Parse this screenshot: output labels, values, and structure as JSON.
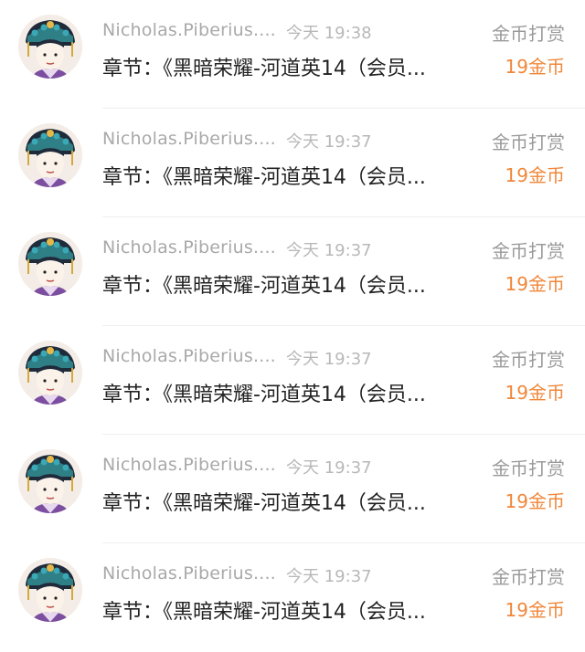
{
  "items": [
    {
      "user": "Nicholas.Piberius....",
      "time": "今天 19:38",
      "action": "金币打赏",
      "chapter": "章节：《黑暗荣耀-河道英14（会员...",
      "amount": "19金币"
    },
    {
      "user": "Nicholas.Piberius....",
      "time": "今天 19:37",
      "action": "金币打赏",
      "chapter": "章节：《黑暗荣耀-河道英14（会员...",
      "amount": "19金币"
    },
    {
      "user": "Nicholas.Piberius....",
      "time": "今天 19:37",
      "action": "金币打赏",
      "chapter": "章节：《黑暗荣耀-河道英14（会员...",
      "amount": "19金币"
    },
    {
      "user": "Nicholas.Piberius....",
      "time": "今天 19:37",
      "action": "金币打赏",
      "chapter": "章节：《黑暗荣耀-河道英14（会员...",
      "amount": "19金币"
    },
    {
      "user": "Nicholas.Piberius....",
      "time": "今天 19:37",
      "action": "金币打赏",
      "chapter": "章节：《黑暗荣耀-河道英14（会员...",
      "amount": "19金币"
    },
    {
      "user": "Nicholas.Piberius....",
      "time": "今天 19:37",
      "action": "金币打赏",
      "chapter": "章节：《黑暗荣耀-河道英14（会员...",
      "amount": "19金币"
    }
  ],
  "colors": {
    "username": "#a9a9a9",
    "time": "#b8b8b8",
    "action": "#9a9a9a",
    "chapter": "#222222",
    "amount": "#f0873a"
  },
  "icons": {
    "avatar": "avatar-icon"
  }
}
